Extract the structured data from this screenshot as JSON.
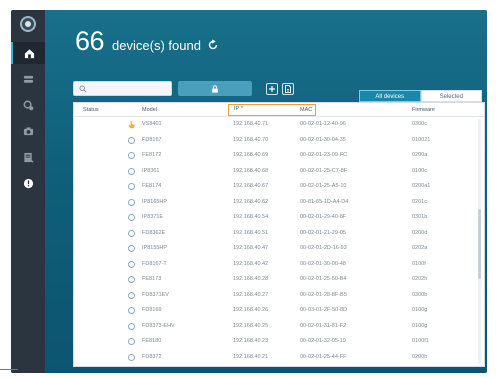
{
  "app": {
    "logo_text": ""
  },
  "header": {
    "count": "66",
    "count_label": "device(s) found"
  },
  "search": {
    "placeholder": "",
    "value": ""
  },
  "tabs": [
    {
      "label": "All devices"
    },
    {
      "label": "Selected"
    }
  ],
  "table": {
    "columns": [
      "Status",
      "Model",
      "IP ^",
      "MAC",
      "Firmware"
    ],
    "rows": [
      {
        "status": "hand",
        "model": "VS8401",
        "ip": "192.168.40.71",
        "mac": "00-02-01-12-40-96",
        "firmware": "0300c"
      },
      {
        "status": "dot",
        "model": "FD8167",
        "ip": "192.168.40.70",
        "mac": "00-02-01-30-04-35",
        "firmware": "010021"
      },
      {
        "status": "dot",
        "model": "FE8172",
        "ip": "192.168.40.69",
        "mac": "00-02-01-23-09-FC",
        "firmware": "0200a"
      },
      {
        "status": "dot",
        "model": "IP8361",
        "ip": "192.168.40.68",
        "mac": "00-02-01-25-C7-8F",
        "firmware": "0100c"
      },
      {
        "status": "dot",
        "model": "FE8174",
        "ip": "192.168.40.67",
        "mac": "00-02-01-25-A5-10",
        "firmware": "0200a1"
      },
      {
        "status": "dot",
        "model": "IP8165HP",
        "ip": "192.168.40.62",
        "mac": "00-81-65-1D-A4-D4",
        "firmware": "0201c"
      },
      {
        "status": "dot",
        "model": "IP8371E",
        "ip": "192.168.40.54",
        "mac": "00-02-01-29-40-8F",
        "firmware": "0301b"
      },
      {
        "status": "dot",
        "model": "FD8362E",
        "ip": "192.168.40.51",
        "mac": "00-02-01-21-29-05",
        "firmware": "0200d"
      },
      {
        "status": "dot",
        "model": "IP8155HP",
        "ip": "192.168.40.47",
        "mac": "00-02-01-2D-16-93",
        "firmware": "0202a"
      },
      {
        "status": "dot",
        "model": "FD8167-T",
        "ip": "192.168.40.42",
        "mac": "00-02-01-30-00-48",
        "firmware": "0100f"
      },
      {
        "status": "dot",
        "model": "FE8173",
        "ip": "192.168.40.28",
        "mac": "00-02-01-25-50-B4",
        "firmware": "0202h"
      },
      {
        "status": "dot",
        "model": "FD8371EV",
        "ip": "192.168.40.27",
        "mac": "00-02-01-28-8F-B5",
        "firmware": "0300b"
      },
      {
        "status": "dot",
        "model": "FD8169",
        "ip": "192.168.40.26",
        "mac": "00-03-01-2F-50-8D",
        "firmware": "0100g"
      },
      {
        "status": "dot",
        "model": "FD8373-EHV",
        "ip": "192.168.40.25",
        "mac": "00-02-01-31-81-F2",
        "firmware": "0100g"
      },
      {
        "status": "dot",
        "model": "FE8180",
        "ip": "192.168.40.23",
        "mac": "00-02-01-32-05-19",
        "firmware": "0100f1"
      },
      {
        "status": "dot",
        "model": "FD8372",
        "ip": "192.168.40.21",
        "mac": "00-02-01-25-44-FF",
        "firmware": "0200h"
      }
    ]
  },
  "colors": {
    "main_bg": "#0f5f7a",
    "sidebar_bg": "#2b3540",
    "accent": "#38b0d0",
    "sort_highlight": "#f0a030"
  },
  "icons": {
    "sidebar": [
      "home-icon",
      "devices-icon",
      "settings-icon",
      "camera-icon",
      "report-icon",
      "info-icon"
    ],
    "search": "search-icon",
    "refresh": "refresh-icon",
    "lock": "lock-icon",
    "add": "add-icon",
    "file": "file-icon"
  }
}
